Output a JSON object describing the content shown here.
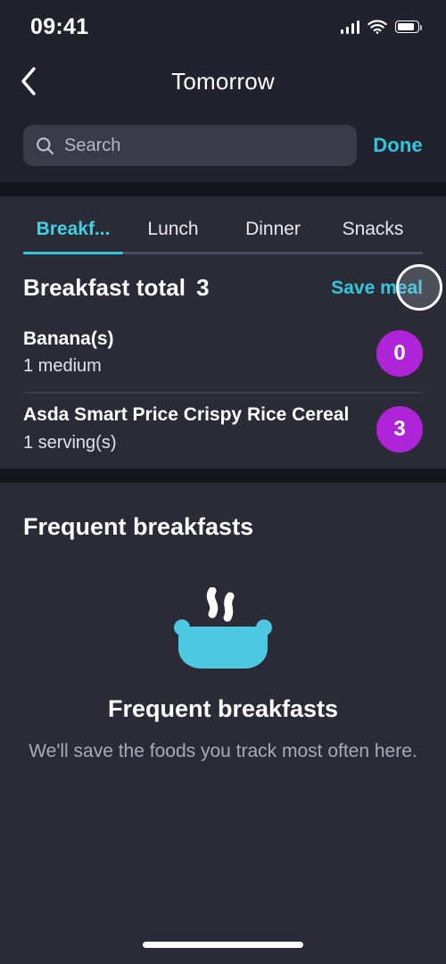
{
  "status_bar": {
    "time": "09:41",
    "signal_icon": "cellular-signal-icon",
    "wifi_icon": "wifi-icon",
    "battery_icon": "battery-icon"
  },
  "nav": {
    "back_icon": "chevron-left-icon",
    "title": "Tomorrow"
  },
  "search": {
    "icon": "search-icon",
    "placeholder": "Search",
    "value": "",
    "done_label": "Done"
  },
  "tabs": {
    "items": [
      {
        "label": "Breakf...",
        "active": true
      },
      {
        "label": "Lunch",
        "active": false
      },
      {
        "label": "Dinner",
        "active": false
      },
      {
        "label": "Snacks",
        "active": false
      }
    ]
  },
  "meal": {
    "total_label": "Breakfast total",
    "total_value": "3",
    "save_label": "Save meal",
    "items": [
      {
        "name": "Banana(s)",
        "serving": "1 medium",
        "points": "0"
      },
      {
        "name": "Asda Smart Price Crispy Rice Cereal",
        "serving": "1 serving(s)",
        "points": "3"
      }
    ]
  },
  "frequent": {
    "section_title": "Frequent breakfasts",
    "empty_icon": "cooking-pot-icon",
    "empty_title": "Frequent breakfasts",
    "empty_subtitle": "We'll save the foods you track most often here."
  },
  "colors": {
    "accent_cyan": "#31c8dd",
    "badge_purple": "#b024d9",
    "background": "#2b2b38",
    "header_background": "#22222e"
  }
}
